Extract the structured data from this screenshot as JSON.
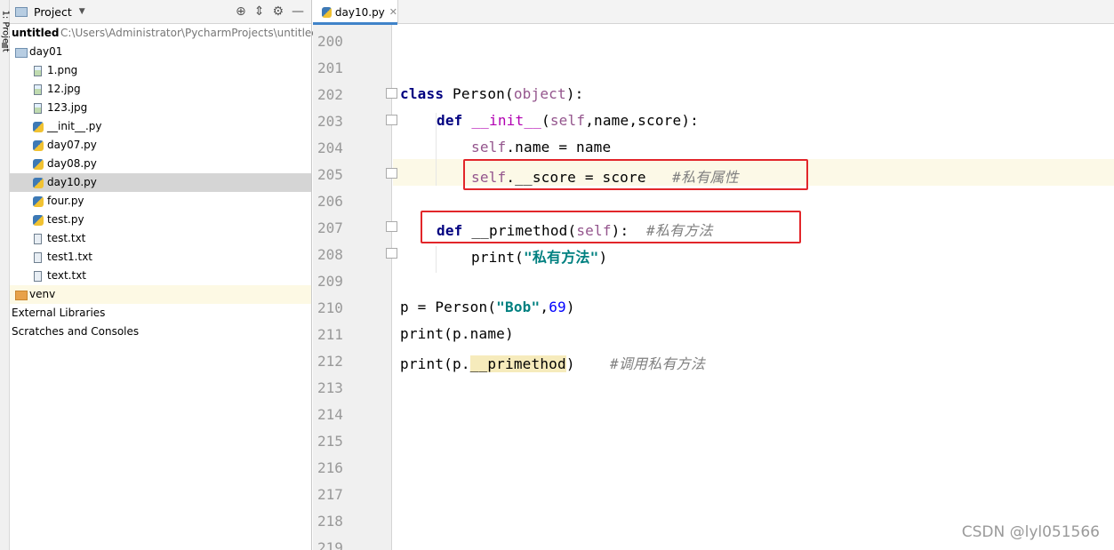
{
  "sidebar_strip": {
    "label": "1: Project"
  },
  "project_panel": {
    "header_title": "Project",
    "root": {
      "name": "untitled",
      "path": "C:\\Users\\Administrator\\PycharmProjects\\untitled"
    },
    "items": [
      {
        "label": "day01",
        "type": "folder"
      },
      {
        "label": "1.png",
        "type": "image"
      },
      {
        "label": "12.jpg",
        "type": "image"
      },
      {
        "label": "123.jpg",
        "type": "image"
      },
      {
        "label": "__init__.py",
        "type": "python"
      },
      {
        "label": "day07.py",
        "type": "python"
      },
      {
        "label": "day08.py",
        "type": "python"
      },
      {
        "label": "day10.py",
        "type": "python",
        "selected": true
      },
      {
        "label": "four.py",
        "type": "python"
      },
      {
        "label": "test.py",
        "type": "python"
      },
      {
        "label": "test.txt",
        "type": "text"
      },
      {
        "label": "test1.txt",
        "type": "text"
      },
      {
        "label": "text.txt",
        "type": "text"
      },
      {
        "label": "venv",
        "type": "folder-excluded"
      },
      {
        "label": "External Libraries",
        "type": "plain"
      },
      {
        "label": "Scratches and Consoles",
        "type": "plain"
      }
    ]
  },
  "editor": {
    "tab_label": "day10.py",
    "line_numbers": [
      "200",
      "201",
      "202",
      "203",
      "204",
      "205",
      "206",
      "207",
      "208",
      "209",
      "210",
      "211",
      "212",
      "213",
      "214",
      "215",
      "216",
      "217",
      "218",
      "219"
    ],
    "code": {
      "l202_class": "class",
      "l202_rest": " Person(",
      "l202_obj": "object",
      "l202_end": "):",
      "l203_def": "def",
      "l203_name": " __init__",
      "l203_open": "(",
      "l203_self": "self",
      "l203_rest": ",name,score):",
      "l204_self": "self",
      "l204_rest": ".name = name",
      "l205_self": "self",
      "l205_rest": ".__score = score   ",
      "l205_comment": "#私有属性",
      "l207_def": "def",
      "l207_rest": " __primethod(",
      "l207_self": "self",
      "l207_end": "):  ",
      "l207_comment": "#私有方法",
      "l208_print": "print(",
      "l208_str": "\"私有方法\"",
      "l208_end": ")",
      "l210_start": "p = Person(",
      "l210_str": "\"Bob\"",
      "l210_comma": ",",
      "l210_num": "69",
      "l210_end": ")",
      "l211": "print(p.name)",
      "l212_start": "print(p.",
      "l212_hl": "__primethod",
      "l212_end": ")    ",
      "l212_comment": "#调用私有方法"
    }
  },
  "watermark": "CSDN @lyl051566",
  "colors": {
    "annotation_box": "#e2262a",
    "current_line": "#fcf9e7",
    "keyword": "#000080"
  }
}
